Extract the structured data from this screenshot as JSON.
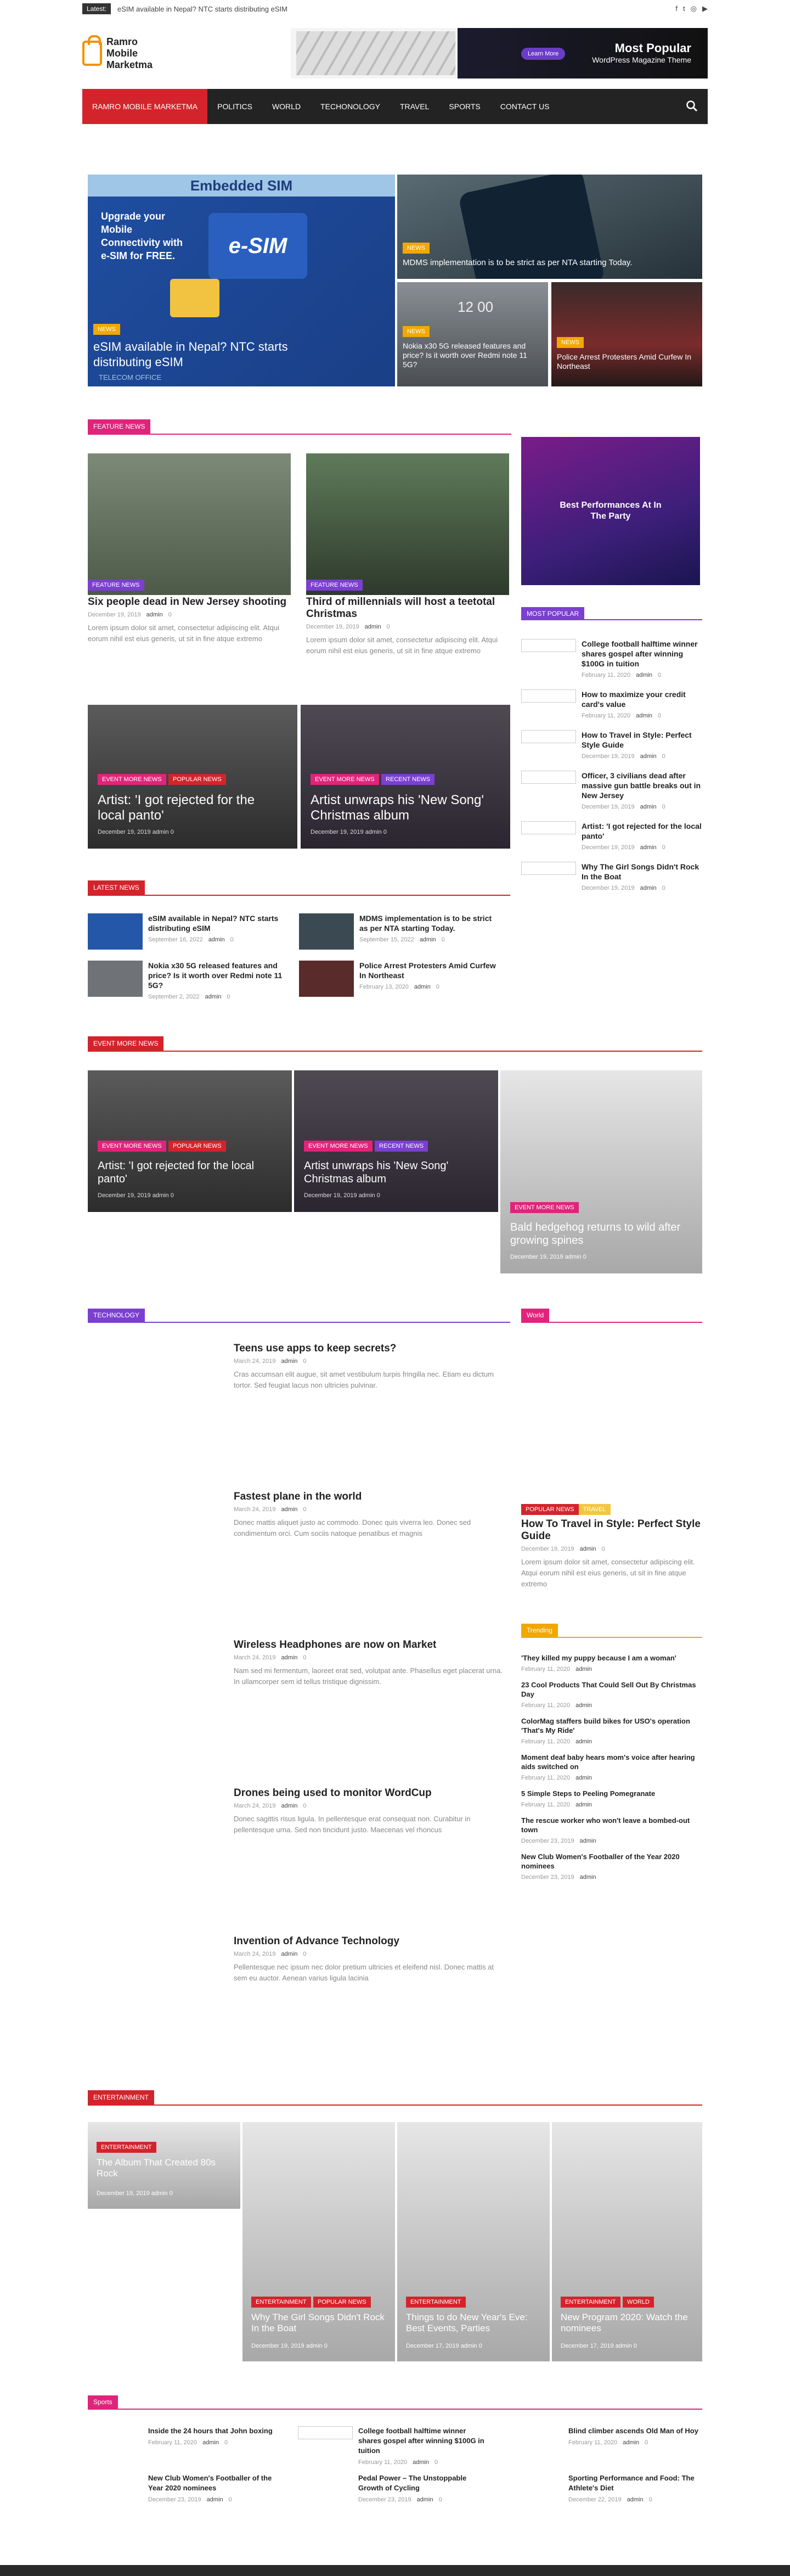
{
  "topbar": {
    "latest_label": "Latest:",
    "latest_text": "eSIM available in Nepal? NTC starts distributing eSIM"
  },
  "site": {
    "name_line1": "Ramro",
    "name_line2": "Mobile",
    "name_line3": "Marketma"
  },
  "banner": {
    "title": "Most Popular",
    "subtitle": "WordPress Magazine Theme",
    "button": "Learn More"
  },
  "nav": {
    "items": [
      "RAMRO MOBILE MARKETMA",
      "POLITICS",
      "WORLD",
      "TECHONOLOGY",
      "TRAVEL",
      "SPORTS",
      "CONTACT US"
    ]
  },
  "hero": {
    "main": {
      "cat": "NEWS",
      "title": "eSIM available in Nepal? NTC starts distributing eSIM",
      "img_title": "Embedded SIM",
      "img_sub": "Upgrade your Mobile Connectivity with e-SIM for FREE.",
      "img_esim": "e-SIM",
      "img_office": "TELECOM OFFICE"
    },
    "top": {
      "cat": "NEWS",
      "title": "MDMS implementation is to be strict as per NTA starting Today."
    },
    "bl": {
      "cat": "NEWS",
      "title": "Nokia x30 5G released features and price? Is it worth over Redmi note 11 5G?",
      "img_text": "12 00"
    },
    "br": {
      "cat": "NEWS",
      "title": "Police Arrest Protesters Amid Curfew In Northeast"
    }
  },
  "feature": {
    "label": "FEATURE NEWS",
    "a": {
      "cat": "FEATURE NEWS",
      "title": "Six people dead in New Jersey shooting",
      "date": "December 19, 2019",
      "author": "admin",
      "comments": "0",
      "excerpt": "Lorem ipsum dolor sit amet, consectetur adipiscing elit. Atqui eorum nihil est eius generis, ut sit in fine atque extremo"
    },
    "b": {
      "cat": "FEATURE NEWS",
      "title": "Third of millennials will host a teetotal Christmas",
      "date": "December 19, 2019",
      "author": "admin",
      "comments": "0",
      "excerpt": "Lorem ipsum dolor sit amet, consectetur adipiscing elit. Atqui eorum nihil est eius generis, ut sit in fine atque extremo"
    },
    "c": {
      "cat1": "EVENT MORE NEWS",
      "cat2": "POPULAR NEWS",
      "title": "Artist: 'I got rejected for the local panto'",
      "date": "December 19, 2019",
      "author": "admin",
      "comments": "0"
    },
    "d": {
      "cat1": "EVENT MORE NEWS",
      "cat2": "RECENT NEWS",
      "title": "Artist unwraps his 'New Song' Christmas album",
      "date": "December 19, 2019",
      "author": "admin",
      "comments": "0"
    }
  },
  "ad": {
    "title": "Best Performances At In The Party"
  },
  "popular": {
    "label": "MOST POPULAR",
    "items": [
      {
        "title": "College football halftime winner shares gospel after winning $100G in tuition",
        "date": "February 11, 2020",
        "author": "admin",
        "comments": "0"
      },
      {
        "title": "How to maximize your credit card's value",
        "date": "February 11, 2020",
        "author": "admin",
        "comments": "0"
      },
      {
        "title": "How to Travel in Style: Perfect Style Guide",
        "date": "December 19, 2019",
        "author": "admin",
        "comments": "0"
      },
      {
        "title": "Officer, 3 civilians dead after massive gun battle breaks out in New Jersey",
        "date": "December 19, 2019",
        "author": "admin",
        "comments": "0"
      },
      {
        "title": "Artist: 'I got rejected for the local panto'",
        "date": "December 19, 2019",
        "author": "admin",
        "comments": "0"
      },
      {
        "title": "Why The Girl Songs Didn't Rock In the Boat",
        "date": "December 19, 2019",
        "author": "admin",
        "comments": "0"
      }
    ]
  },
  "latest": {
    "label": "LATEST NEWS",
    "items": [
      {
        "title": "eSIM available in Nepal? NTC starts distributing eSIM",
        "date": "September 16, 2022",
        "author": "admin",
        "comments": "0"
      },
      {
        "title": "MDMS implementation is to be strict as per NTA starting Today.",
        "date": "September 15, 2022",
        "author": "admin",
        "comments": "0"
      },
      {
        "title": "Nokia x30 5G released features and price? Is it worth over Redmi note 11 5G?",
        "date": "September 2, 2022",
        "author": "admin",
        "comments": "0"
      },
      {
        "title": "Police Arrest Protesters Amid Curfew In Northeast",
        "date": "February 13, 2020",
        "author": "admin",
        "comments": "0"
      }
    ]
  },
  "event": {
    "label": "EVENT MORE NEWS",
    "items": [
      {
        "cat1": "EVENT MORE NEWS",
        "cat2": "POPULAR NEWS",
        "title": "Artist: 'I got rejected for the local panto'",
        "date": "December 19, 2019",
        "author": "admin",
        "comments": "0"
      },
      {
        "cat1": "EVENT MORE NEWS",
        "cat2": "RECENT NEWS",
        "title": "Artist unwraps his 'New Song' Christmas album",
        "date": "December 19, 2019",
        "author": "admin",
        "comments": "0"
      },
      {
        "cat1": "EVENT MORE NEWS",
        "title": "Bald hedgehog returns to wild after growing spines",
        "date": "December 19, 2019",
        "author": "admin",
        "comments": "0"
      }
    ]
  },
  "tech": {
    "label": "TECHNOLOGY",
    "items": [
      {
        "title": "Teens use apps to keep secrets?",
        "date": "March 24, 2019",
        "author": "admin",
        "comments": "0",
        "excerpt": "Cras accumsan elit augue, sit amet vestibulum turpis fringilla nec. Etiam eu dictum tortor. Sed feugiat lacus non ultricies pulvinar."
      },
      {
        "title": "Fastest plane in the world",
        "date": "March 24, 2019",
        "author": "admin",
        "comments": "0",
        "excerpt": "Donec mattis aliquet justo ac commodo. Donec quis viverra leo. Donec sed condimentum orci. Cum sociis natoque penatibus et magnis"
      },
      {
        "title": "Wireless Headphones are now on Market",
        "date": "March 24, 2019",
        "author": "admin",
        "comments": "0",
        "excerpt": "Nam sed mi fermentum, laoreet erat sed, volutpat ante. Phasellus eget placerat urna. In ullamcorper sem id tellus tristique dignissim."
      },
      {
        "title": "Drones being used to monitor WordCup",
        "date": "March 24, 2019",
        "author": "admin",
        "comments": "0",
        "excerpt": "Donec sagittis risus ligula. In pellentesque erat consequat non. Curabitur in pellentesque urna. Sed non tincidunt justo. Maecenas vel rhoncus"
      },
      {
        "title": "Invention of Advance Technology",
        "date": "March 24, 2019",
        "author": "admin",
        "comments": "0",
        "excerpt": "Pellentesque nec ipsum nec dolor pretium ultricies et eleifend nisl. Donec mattis at sem eu auctor. Aenean varius ligula lacinia"
      }
    ]
  },
  "world": {
    "label": "World",
    "cat1": "POPULAR NEWS",
    "cat2": "TRAVEL",
    "title": "How To Travel in Style: Perfect Style Guide",
    "date": "December 19, 2019",
    "author": "admin",
    "comments": "0",
    "excerpt": "Lorem ipsum dolor sit amet, consectetur adipiscing elit. Atqui eorum nihil est eius generis, ut sit in fine atque extremo"
  },
  "trending": {
    "label": "Trending",
    "items": [
      {
        "title": "'They killed my puppy because I am a woman'",
        "date": "February 11, 2020",
        "author": "admin"
      },
      {
        "title": "23 Cool Products That Could Sell Out By Christmas Day",
        "date": "February 11, 2020",
        "author": "admin"
      },
      {
        "title": "ColorMag staffers build bikes for USO's operation 'That's My Ride'",
        "date": "February 11, 2020",
        "author": "admin"
      },
      {
        "title": "Moment deaf baby hears mom's voice after hearing aids switched on",
        "date": "February 11, 2020",
        "author": "admin"
      },
      {
        "title": "5 Simple Steps to Peeling Pomegranate",
        "date": "February 11, 2020",
        "author": "admin"
      },
      {
        "title": "The rescue worker who won't leave a bombed-out town",
        "date": "December 23, 2019",
        "author": "admin"
      },
      {
        "title": "New Club Women's Footballer of the Year 2020 nominees",
        "date": "December 23, 2019",
        "author": "admin"
      }
    ]
  },
  "ent": {
    "label": "ENTERTAINMENT",
    "items": [
      {
        "cat1": "ENTERTAINMENT",
        "title": "The Album That Created 80s Rock",
        "date": "December 19, 2019",
        "author": "admin",
        "comments": "0"
      },
      {
        "cat1": "ENTERTAINMENT",
        "cat2": "POPULAR NEWS",
        "title": "Why The Girl Songs Didn't Rock In the Boat",
        "date": "December 19, 2019",
        "author": "admin",
        "comments": "0"
      },
      {
        "cat1": "ENTERTAINMENT",
        "title": "Things to do New Year's Eve: Best Events, Parties",
        "date": "December 17, 2019",
        "author": "admin",
        "comments": "0"
      },
      {
        "cat1": "ENTERTAINMENT",
        "cat2": "WORLD",
        "title": "New Program 2020: Watch the nominees",
        "date": "December 17, 2019",
        "author": "admin",
        "comments": "0"
      }
    ]
  },
  "sports": {
    "label": "Sports",
    "items": [
      {
        "title": "Inside the 24 hours that John boxing",
        "date": "February 11, 2020",
        "author": "admin",
        "comments": "0"
      },
      {
        "title": "College football halftime winner shares gospel after winning $100G in tuition",
        "date": "February 11, 2020",
        "author": "admin",
        "comments": "0"
      },
      {
        "title": "Blind climber ascends Old Man of Hoy",
        "date": "February 11, 2020",
        "author": "admin",
        "comments": "0"
      },
      {
        "title": "New Club Women's Footballer of the Year 2020 nominees",
        "date": "December 23, 2019",
        "author": "admin",
        "comments": "0"
      },
      {
        "title": "Pedal Power – The Unstoppable Growth of Cycling",
        "date": "December 23, 2019",
        "author": "admin",
        "comments": "0"
      },
      {
        "title": "Sporting Performance and Food: The Athlete's Diet",
        "date": "December 22, 2019",
        "author": "admin",
        "comments": "0"
      }
    ]
  },
  "colors": {
    "red": "#d3242c",
    "pink": "#e0247b",
    "purple": "#7b3fd1",
    "orange": "#f2a800",
    "dark": "#232323"
  }
}
